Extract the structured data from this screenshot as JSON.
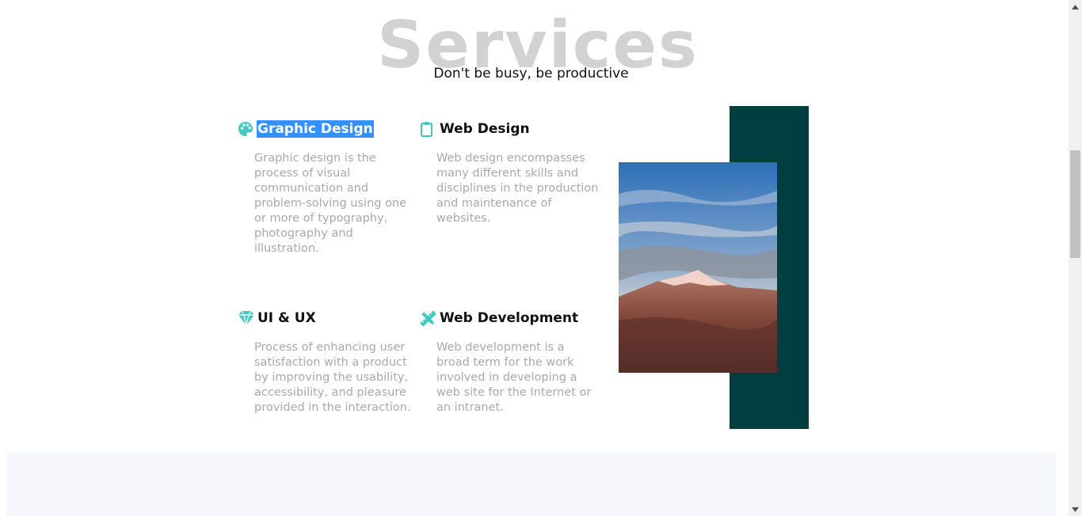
{
  "section": {
    "title": "Services",
    "subtitle": "Don't be busy, be productive"
  },
  "services": [
    {
      "icon": "palette-icon",
      "title": "Graphic Design",
      "selected": true,
      "description": "Graphic design is the process of visual communication and problem-solving using one or more of typography, photography and illustration."
    },
    {
      "icon": "clipboard-icon",
      "title": "Web Design",
      "selected": false,
      "description": "Web design encompasses many different skills and disciplines in the production and maintenance of websites."
    },
    {
      "icon": "gem-icon",
      "title": "UI & UX",
      "selected": false,
      "description": "Process of enhancing user satisfaction with a product by improving the usability, accessibility, and pleasure provided in the interaction."
    },
    {
      "icon": "pencil-ruler-icon",
      "title": "Web Development",
      "selected": false,
      "description": "Web development is a broad term for the work involved in developing a web site for the Internet or an intranet."
    }
  ],
  "colors": {
    "icon_accent": "#3fc9c2",
    "teal_block": "#003e3f",
    "selection": "#3390ff",
    "title_gray": "#d2d2d2",
    "desc_gray": "#a9a9a9"
  },
  "image": {
    "subject": "mountain-landscape"
  }
}
